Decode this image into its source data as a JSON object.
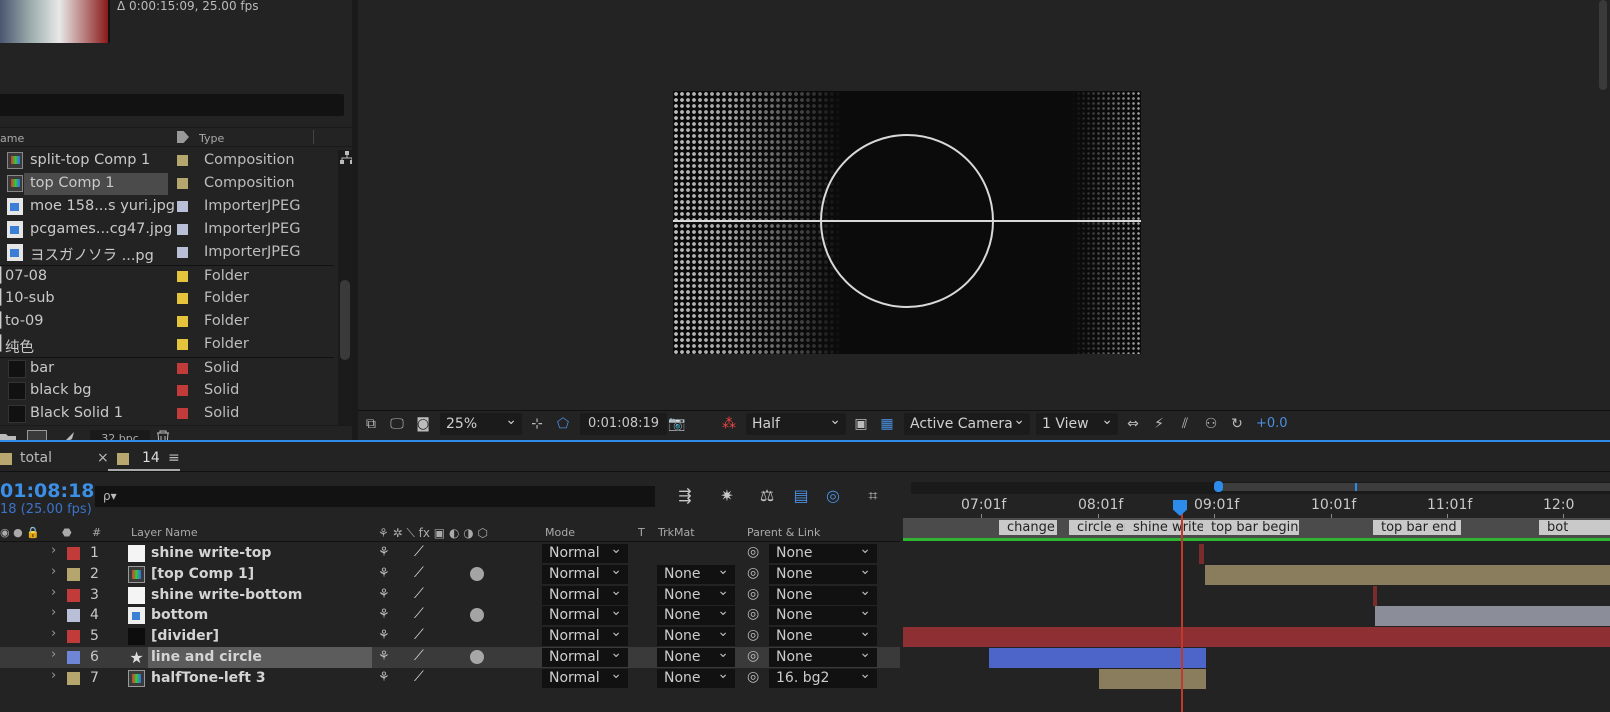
{
  "project": {
    "info": "Δ 0:00:15:09, 25.00 fps",
    "col_name": "ame",
    "col_type": "Type",
    "items": [
      {
        "name": "split-top Comp 1",
        "type": "Composition",
        "icon": "composition-icon",
        "color": "#b5a66e"
      },
      {
        "name": "top Comp 1",
        "type": "Composition",
        "icon": "composition-icon",
        "color": "#b5a66e",
        "selected": true
      },
      {
        "name": "moe 158...s yuri.jpg",
        "type": "ImporterJPEG",
        "icon": "jpeg-icon",
        "color": "#b8bfd6"
      },
      {
        "name": "pcgames...cg47.jpg",
        "type": "ImporterJPEG",
        "icon": "jpeg-icon",
        "color": "#b8bfd6"
      },
      {
        "name": "ヨスガノソラ ...pg",
        "type": "ImporterJPEG",
        "icon": "jpeg-icon",
        "color": "#b8bfd6"
      },
      {
        "name": "07-08",
        "type": "Folder",
        "icon": "folder-icon",
        "color": "#e3c43c"
      },
      {
        "name": "10-sub",
        "type": "Folder",
        "icon": "folder-icon",
        "color": "#e3c43c"
      },
      {
        "name": "to-09",
        "type": "Folder",
        "icon": "folder-icon",
        "color": "#e3c43c"
      },
      {
        "name": "纯色",
        "type": "Folder",
        "icon": "folder-icon",
        "color": "#e3c43c"
      },
      {
        "name": "bar",
        "type": "Solid",
        "icon": "solid-icon",
        "color": "#c23b3b"
      },
      {
        "name": "black bg",
        "type": "Solid",
        "icon": "solid-icon",
        "color": "#c23b3b"
      },
      {
        "name": "Black Solid 1",
        "type": "Solid",
        "icon": "solid-icon",
        "color": "#c23b3b"
      }
    ],
    "bpc": "32 bpc"
  },
  "viewer": {
    "zoom": "25%",
    "timecode": "0:01:08:19",
    "resolution": "Half",
    "camera": "Active Camera",
    "views": "1 View",
    "exposure": "+0.0"
  },
  "timeline": {
    "tabs": [
      {
        "label": "total"
      },
      {
        "label": "14"
      }
    ],
    "current_time": "01:08:18",
    "fps_text": "18 (25.00 fps)",
    "search_placeholder": "ρ▾",
    "columns": {
      "num": "#",
      "layer_name": "Layer Name",
      "mode": "Mode",
      "t": "T",
      "trkmat": "TrkMat",
      "parent": "Parent & Link"
    },
    "ruler_ticks": [
      "07:01f",
      "08:01f",
      "09:01f",
      "10:01f",
      "11:01f",
      "12:0"
    ],
    "markers": [
      "change",
      "circle en",
      "shine write",
      "top bar begin",
      "top bar end",
      "bot"
    ],
    "layers": [
      {
        "num": "1",
        "name": "shine write-top",
        "color": "#c23b3b",
        "icon": "white",
        "mode": "Normal",
        "trkmat": "",
        "parent": "None"
      },
      {
        "num": "2",
        "name": "[top Comp 1]",
        "color": "#b5a66e",
        "icon": "comp",
        "mode": "Normal",
        "trkmat": "None",
        "parent": "None"
      },
      {
        "num": "3",
        "name": "shine write-bottom",
        "color": "#c23b3b",
        "icon": "white",
        "mode": "Normal",
        "trkmat": "None",
        "parent": "None"
      },
      {
        "num": "4",
        "name": "bottom",
        "color": "#b8bfd6",
        "icon": "img",
        "mode": "Normal",
        "trkmat": "None",
        "parent": "None"
      },
      {
        "num": "5",
        "name": "[divider]",
        "color": "#c23b3b",
        "icon": "black",
        "mode": "Normal",
        "trkmat": "None",
        "parent": "None"
      },
      {
        "num": "6",
        "name": "line and circle",
        "color": "#6f86d6",
        "icon": "star",
        "mode": "Normal",
        "trkmat": "None",
        "parent": "None",
        "selected": true
      },
      {
        "num": "7",
        "name": "halfTone-left 3",
        "color": "#b5a66e",
        "icon": "comp",
        "mode": "Normal",
        "trkmat": "None",
        "parent": "16. bg2"
      }
    ],
    "colors": {
      "accent": "#2d8ceb",
      "playhead": "#c0392b",
      "work_area": "#2fb52f"
    }
  }
}
